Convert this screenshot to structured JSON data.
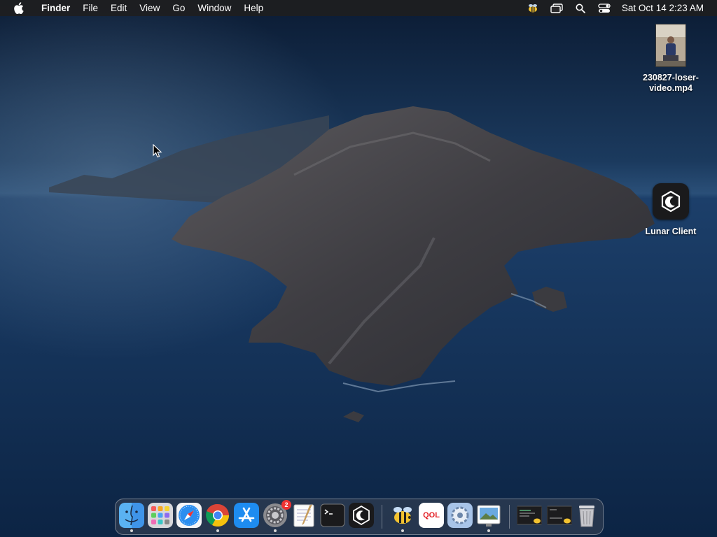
{
  "menubar": {
    "app_name": "Finder",
    "menus": [
      "File",
      "Edit",
      "View",
      "Go",
      "Window",
      "Help"
    ],
    "clock": "Sat Oct 14  2:23 AM",
    "status_icons": [
      "bee-menu-icon",
      "screen-mirroring-icon",
      "spotlight-search-icon",
      "control-center-icon"
    ]
  },
  "desktop": {
    "icons": [
      {
        "label_line1": "230827-loser-",
        "label_line2": "video.mp4",
        "icon": "video-file-icon"
      },
      {
        "label": "Lunar Client",
        "icon": "lunar-client-icon"
      }
    ]
  },
  "dock": {
    "apps": [
      {
        "name": "Finder",
        "icon": "finder-icon",
        "running": true
      },
      {
        "name": "Launchpad",
        "icon": "launchpad-icon",
        "running": false
      },
      {
        "name": "Safari",
        "icon": "safari-icon",
        "running": false
      },
      {
        "name": "Google Chrome",
        "icon": "chrome-icon",
        "running": true
      },
      {
        "name": "App Store",
        "icon": "app-store-icon",
        "running": false
      },
      {
        "name": "System Preferences",
        "icon": "system-preferences-icon",
        "running": true,
        "badge": "2"
      },
      {
        "name": "TextEdit",
        "icon": "textedit-icon",
        "running": false
      },
      {
        "name": "Terminal",
        "icon": "terminal-icon",
        "running": false
      },
      {
        "name": "Lunar Client",
        "icon": "lunar-client-icon",
        "running": false
      },
      {
        "name": "Bee app",
        "icon": "bee-icon",
        "running": true
      },
      {
        "name": "QOL",
        "icon": "qol-icon",
        "label": "QOL",
        "running": false
      },
      {
        "name": "Settings utility",
        "icon": "gear-utility-icon",
        "running": false
      },
      {
        "name": "Preview",
        "icon": "preview-icon",
        "running": true
      },
      {
        "name": "Minimized window 1",
        "icon": "minimized-window-icon",
        "running": false
      },
      {
        "name": "Minimized window 2",
        "icon": "minimized-window-icon",
        "running": false
      },
      {
        "name": "Trash",
        "icon": "trash-icon",
        "running": false
      }
    ]
  },
  "colors": {
    "menubar_bg": "#1e1e20",
    "sky_top": "#0c1e38",
    "sea": "#163a66",
    "island": "#4a4a4e"
  }
}
